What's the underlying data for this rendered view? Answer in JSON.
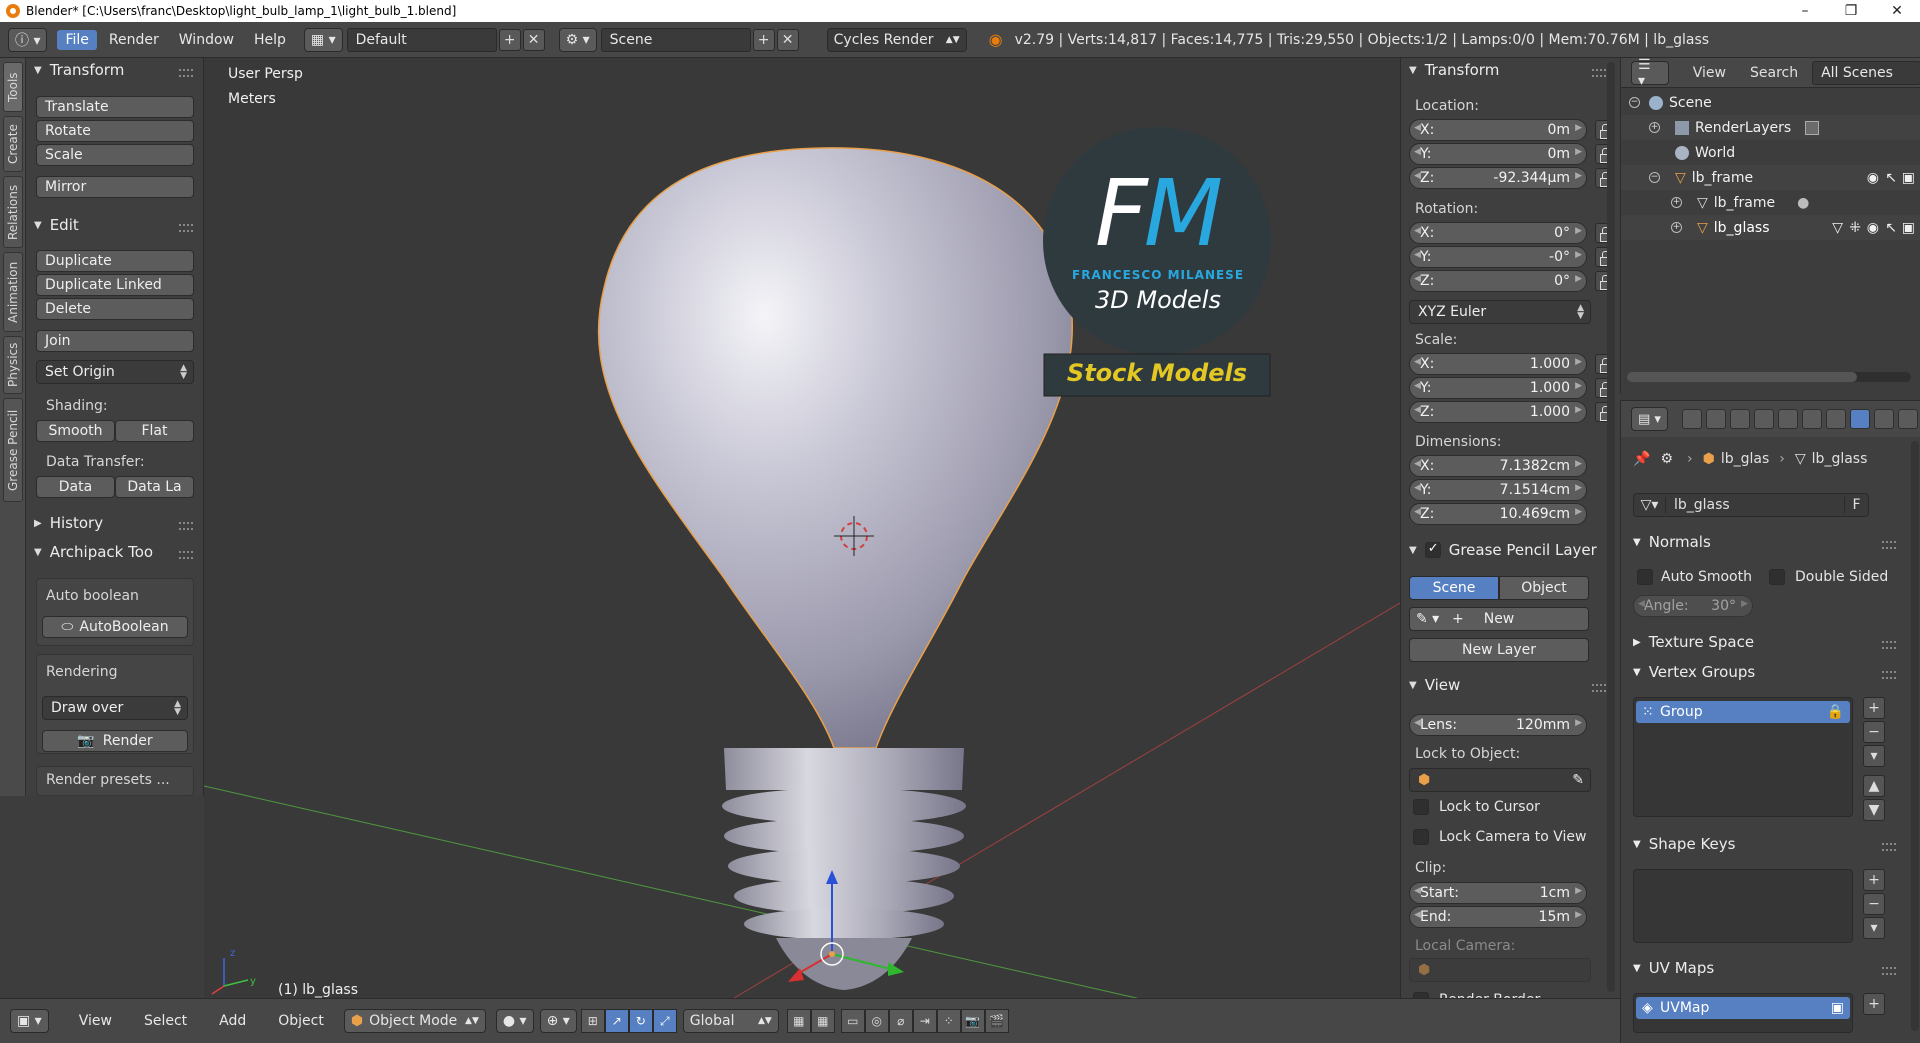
{
  "window": {
    "title": "Blender* [C:\\Users\\franc\\Desktop\\light_bulb_lamp_1\\light_bulb_1.blend]",
    "controls": [
      "–",
      "❐",
      "✕"
    ]
  },
  "menubar": {
    "menus": [
      "File",
      "Render",
      "Window",
      "Help"
    ],
    "active_menu": "File",
    "layout": "Default",
    "scene": "Scene",
    "engine": "Cycles Render",
    "stats": "v2.79 | Verts:14,817 | Faces:14,775 | Tris:29,550 | Objects:1/2 | Lamps:0/0 | Mem:70.76M | lb_glass"
  },
  "tooltabs": [
    "Tools",
    "Create",
    "Relations",
    "Animation",
    "Physics",
    "Grease Pencil"
  ],
  "toolshelf": {
    "transform_title": "Transform",
    "translate": "Translate",
    "rotate": "Rotate",
    "scale": "Scale",
    "mirror": "Mirror",
    "edit_title": "Edit",
    "duplicate": "Duplicate",
    "duplicate_linked": "Duplicate Linked",
    "delete": "Delete",
    "join": "Join",
    "set_origin": "Set Origin",
    "shading_label": "Shading:",
    "smooth": "Smooth",
    "flat": "Flat",
    "data_transfer_label": "Data Transfer:",
    "data": "Data",
    "data_la": "Data La",
    "history_title": "History",
    "archipack_title": "Archipack Too",
    "auto_boolean_label": "Auto boolean",
    "autoboolean_btn": "AutoBoolean",
    "rendering_label": "Rendering",
    "draw_over": "Draw over",
    "render_btn": "Render",
    "render_presets": "Render presets ..."
  },
  "viewport": {
    "view_name": "User Persp",
    "units": "Meters",
    "object_label": "(1) lb_glass",
    "watermark": {
      "initials": "FM",
      "name": "FRANCESCO MILANESE",
      "tagline": "3D Models",
      "banner": "Stock Models"
    }
  },
  "npanel": {
    "transform_title": "Transform",
    "location_label": "Location:",
    "location": [
      {
        "axis": "X:",
        "value": "0m"
      },
      {
        "axis": "Y:",
        "value": "0m"
      },
      {
        "axis": "Z:",
        "value": "-92.344μm"
      }
    ],
    "rotation_label": "Rotation:",
    "rotation": [
      {
        "axis": "X:",
        "value": "0°"
      },
      {
        "axis": "Y:",
        "value": "-0°"
      },
      {
        "axis": "Z:",
        "value": "0°"
      }
    ],
    "rotation_mode": "XYZ Euler",
    "scale_label": "Scale:",
    "scale": [
      {
        "axis": "X:",
        "value": "1.000"
      },
      {
        "axis": "Y:",
        "value": "1.000"
      },
      {
        "axis": "Z:",
        "value": "1.000"
      }
    ],
    "dimensions_label": "Dimensions:",
    "dimensions": [
      {
        "axis": "X:",
        "value": "7.1382cm"
      },
      {
        "axis": "Y:",
        "value": "7.1514cm"
      },
      {
        "axis": "Z:",
        "value": "10.469cm"
      }
    ],
    "gp_title": "Grease Pencil Layer",
    "gp_scene": "Scene",
    "gp_object": "Object",
    "gp_new": "New",
    "gp_new_layer": "New Layer",
    "view_title": "View",
    "lens_label": "Lens:",
    "lens_value": "120mm",
    "lock_to_object": "Lock to Object:",
    "lock_to_cursor": "Lock to Cursor",
    "lock_camera": "Lock Camera to View",
    "clip_label": "Clip:",
    "clip_start_label": "Start:",
    "clip_start": "1cm",
    "clip_end_label": "End:",
    "clip_end": "15m",
    "local_camera": "Local Camera:",
    "render_border": "Render Border"
  },
  "outliner": {
    "header": {
      "view": "View",
      "search": "Search",
      "filter": "All Scenes"
    },
    "rows": [
      {
        "label": "Scene"
      },
      {
        "label": "RenderLayers"
      },
      {
        "label": "World"
      },
      {
        "label": "lb_frame"
      },
      {
        "label": "lb_frame"
      },
      {
        "label": "lb_glass"
      }
    ]
  },
  "properties": {
    "breadcrumb_obj": "lb_glas",
    "breadcrumb_data": "lb_glass",
    "datablock_name": "lb_glass",
    "fake_user": "F",
    "normals_title": "Normals",
    "auto_smooth": "Auto Smooth",
    "double_sided": "Double Sided",
    "angle_label": "Angle:",
    "angle_value": "30°",
    "texture_space": "Texture Space",
    "vertex_groups": "Vertex Groups",
    "group_item": "Group",
    "shape_keys": "Shape Keys",
    "uv_maps": "UV Maps",
    "uvmap_item": "UVMap"
  },
  "bottombar": {
    "menus": [
      "View",
      "Select",
      "Add",
      "Object"
    ],
    "mode": "Object Mode",
    "orientation": "Global"
  },
  "colors": {
    "accent": "#5680c2",
    "outline": "#e8a04a",
    "watermark_bg": "#2f3a3f",
    "watermark_blue": "#29a8e0",
    "watermark_yellow": "#e3c722"
  }
}
